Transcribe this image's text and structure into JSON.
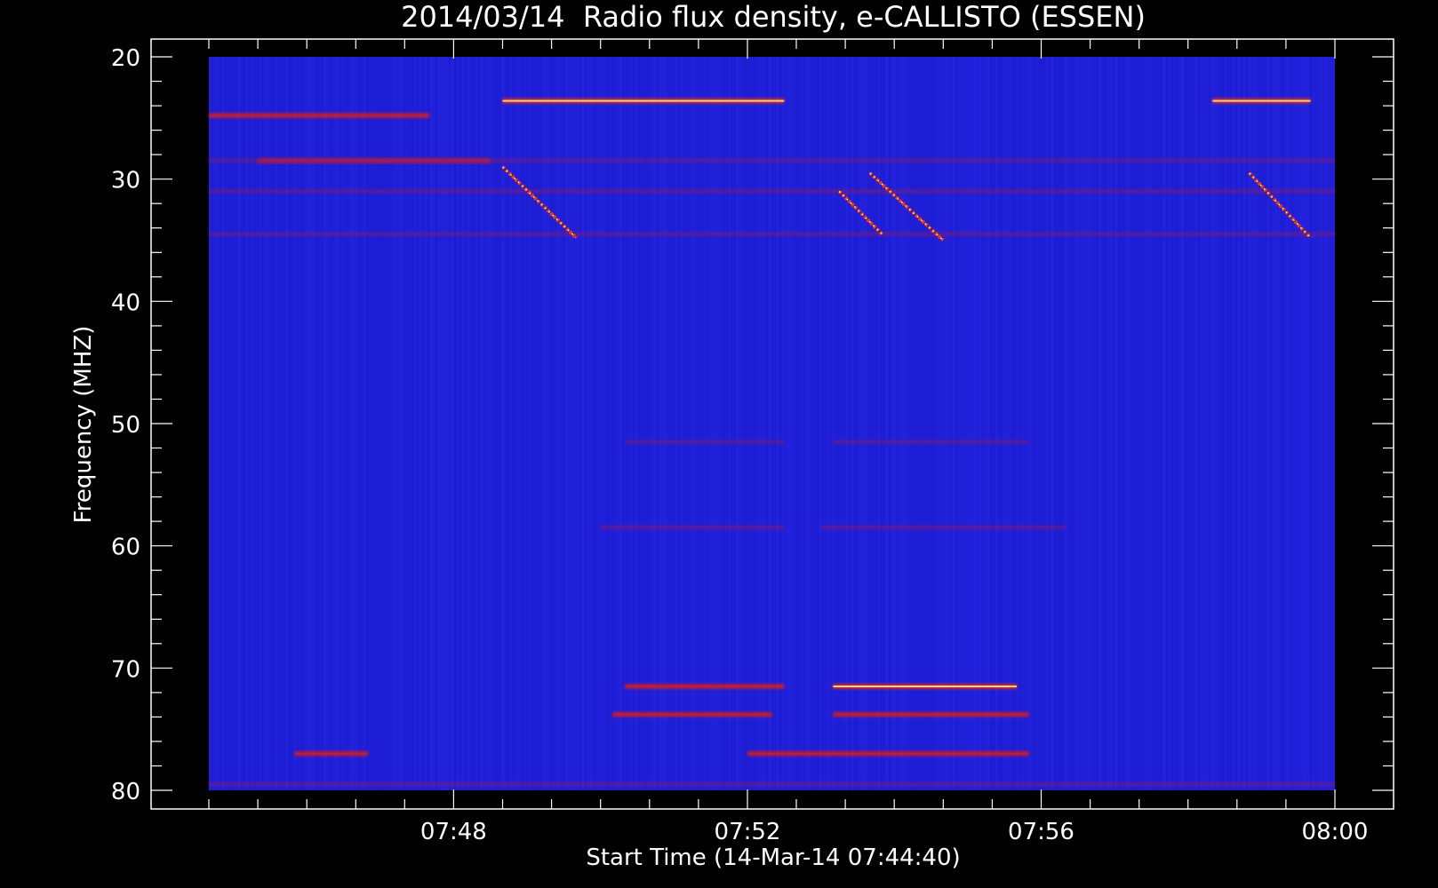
{
  "chart_data": {
    "type": "heatmap",
    "title": "2014/03/14  Radio flux density, e-CALLISTO (ESSEN)",
    "xlabel": "Start Time (14-Mar-14 07:44:40)",
    "ylabel": "Frequency (MHZ)",
    "x_start": "07:44:40",
    "x_end": "08:00:00",
    "x_ticks": [
      "07:48",
      "07:52",
      "07:56",
      "08:00"
    ],
    "y_ticks": [
      20,
      30,
      40,
      50,
      60,
      70,
      80
    ],
    "ylim": [
      80,
      20
    ],
    "y_inverted": true,
    "colormap": [
      "#000000",
      "#0000ff",
      "#ff0000",
      "#ffff99"
    ],
    "background_color": "#1f1fd8",
    "horizontal_bands": [
      {
        "freq": 23.6,
        "start": "07:48:40",
        "end": "07:52:30",
        "intensity": "high"
      },
      {
        "freq": 23.6,
        "start": "07:58:20",
        "end": "07:59:40",
        "intensity": "high"
      },
      {
        "freq": 24.8,
        "start": "07:44:40",
        "end": "07:47:40",
        "intensity": "medium"
      },
      {
        "freq": 28.5,
        "start": "07:45:20",
        "end": "07:48:30",
        "intensity": "medium"
      },
      {
        "freq": 28.5,
        "start": "07:44:40",
        "end": "08:00:00",
        "intensity": "low"
      },
      {
        "freq": 31.0,
        "start": "07:44:40",
        "end": "08:00:00",
        "intensity": "low"
      },
      {
        "freq": 34.5,
        "start": "07:44:40",
        "end": "08:00:00",
        "intensity": "low"
      },
      {
        "freq": 51.5,
        "start": "07:50:20",
        "end": "07:52:30",
        "intensity": "low"
      },
      {
        "freq": 51.5,
        "start": "07:53:10",
        "end": "07:55:50",
        "intensity": "low"
      },
      {
        "freq": 58.5,
        "start": "07:50:00",
        "end": "07:52:30",
        "intensity": "low"
      },
      {
        "freq": 58.5,
        "start": "07:53:00",
        "end": "07:56:20",
        "intensity": "low"
      },
      {
        "freq": 71.5,
        "start": "07:50:20",
        "end": "07:52:30",
        "intensity": "medium"
      },
      {
        "freq": 71.5,
        "start": "07:53:10",
        "end": "07:55:40",
        "intensity": "high"
      },
      {
        "freq": 73.8,
        "start": "07:50:10",
        "end": "07:52:20",
        "intensity": "medium"
      },
      {
        "freq": 73.8,
        "start": "07:53:10",
        "end": "07:55:50",
        "intensity": "medium"
      },
      {
        "freq": 77.0,
        "start": "07:45:50",
        "end": "07:46:50",
        "intensity": "medium"
      },
      {
        "freq": 77.0,
        "start": "07:52:00",
        "end": "07:55:50",
        "intensity": "medium"
      },
      {
        "freq": 79.5,
        "start": "07:44:40",
        "end": "08:00:00",
        "intensity": "low"
      }
    ],
    "drifting_bursts": [
      {
        "start": "07:48:40",
        "end": "07:49:40",
        "freq_start": 29.0,
        "freq_end": 34.8
      },
      {
        "start": "07:53:40",
        "end": "07:54:40",
        "freq_start": 29.5,
        "freq_end": 35.0
      },
      {
        "start": "07:53:15",
        "end": "07:53:50",
        "freq_start": 31.0,
        "freq_end": 34.5
      },
      {
        "start": "07:58:50",
        "end": "07:59:40",
        "freq_start": 29.5,
        "freq_end": 34.8
      }
    ],
    "grid": false,
    "legend": "none"
  }
}
